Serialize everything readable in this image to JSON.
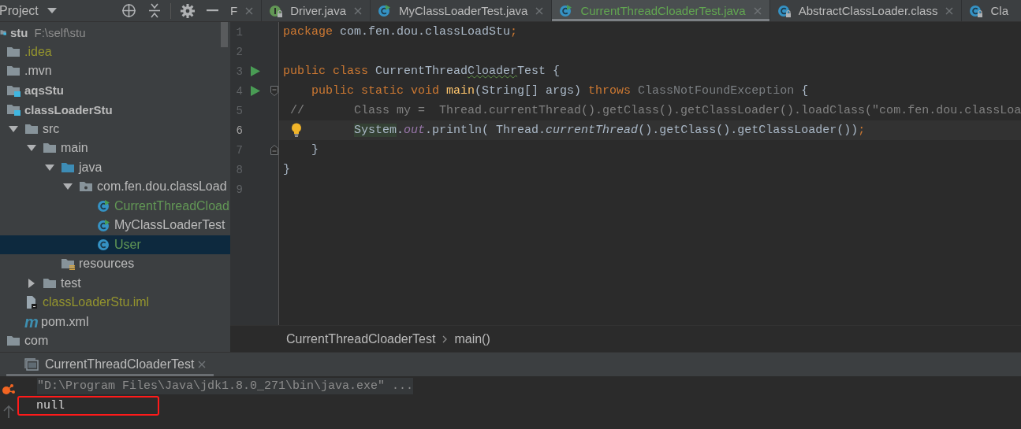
{
  "project_panel": {
    "title": "Project",
    "tree": [
      {
        "label": "stu",
        "kind": "module",
        "path": "F:\\self\\stu",
        "color": "#bbbbbb",
        "selected": false,
        "children": [
          {
            "label": ".idea",
            "kind": "folder",
            "color": "#94942e",
            "selected": false
          },
          {
            "label": ".mvn",
            "kind": "folder",
            "color": "#bbbbbb",
            "selected": false
          },
          {
            "label": "aqsStu",
            "kind": "module",
            "color": "#bbbbbb",
            "selected": false
          },
          {
            "label": "classLoaderStu",
            "kind": "module",
            "color": "#bbbbbb",
            "selected": false,
            "children": [
              {
                "label": "src",
                "kind": "folder",
                "color": "#bbbbbb",
                "expanded": true,
                "selected": false,
                "children": [
                  {
                    "label": "main",
                    "kind": "folder",
                    "color": "#bbbbbb",
                    "expanded": true,
                    "selected": false,
                    "children": [
                      {
                        "label": "java",
                        "kind": "source-folder",
                        "color": "#bbbbbb",
                        "expanded": true,
                        "selected": false,
                        "children": [
                          {
                            "label": "com.fen.dou.classLoad",
                            "kind": "package",
                            "color": "#bbbbbb",
                            "expanded": true,
                            "selected": false,
                            "children": [
                              {
                                "label": "CurrentThreadCload",
                                "kind": "runnable-class",
                                "color": "#629755",
                                "selected": false
                              },
                              {
                                "label": "MyClassLoaderTest",
                                "kind": "runnable-class",
                                "color": "#bbbbbb",
                                "selected": false
                              },
                              {
                                "label": "User",
                                "kind": "class",
                                "color": "#629755",
                                "selected": true
                              }
                            ]
                          }
                        ]
                      },
                      {
                        "label": "resources",
                        "kind": "resources-folder",
                        "color": "#bbbbbb",
                        "selected": false
                      }
                    ]
                  },
                  {
                    "label": "test",
                    "kind": "folder",
                    "color": "#bbbbbb",
                    "expanded": false,
                    "selected": false
                  }
                ]
              },
              {
                "label": "classLoaderStu.iml",
                "kind": "iml-file",
                "color": "#94942e",
                "selected": false
              },
              {
                "label": "pom.xml",
                "kind": "maven-file",
                "icon_text": "m",
                "color": "#bbbbbb",
                "selected": false
              }
            ]
          },
          {
            "label": "com",
            "kind": "folder",
            "color": "#bbbbbb",
            "selected": false
          }
        ]
      }
    ]
  },
  "editor_tabs": [
    {
      "label": "F",
      "kind": "none",
      "locked": false,
      "selected": false,
      "cut_start": true,
      "cut_end": false
    },
    {
      "label": "Driver.java",
      "kind": "interface",
      "locked": true,
      "selected": false,
      "cut_start": false,
      "cut_end": false
    },
    {
      "label": "MyClassLoaderTest.java",
      "kind": "runnable-class",
      "locked": false,
      "selected": false,
      "cut_start": false,
      "cut_end": false
    },
    {
      "label": "CurrentThreadCloaderTest.java",
      "kind": "runnable-class",
      "locked": false,
      "selected": true,
      "cut_start": false,
      "cut_end": false
    },
    {
      "label": "AbstractClassLoader.class",
      "kind": "compiled-class",
      "locked": true,
      "selected": false,
      "cut_start": false,
      "cut_end": false
    },
    {
      "label": "Cla",
      "kind": "compiled-class",
      "locked": true,
      "selected": false,
      "cut_start": false,
      "cut_end": true
    }
  ],
  "editor": {
    "lines": [
      {
        "number": "1",
        "run": false,
        "fold_start": false,
        "fold_end": false,
        "bulb": false,
        "current": false,
        "tokens": [
          {
            "text": "package",
            "kind": "keyword"
          },
          {
            "text": " com.fen.dou.classLoadStu",
            "kind": "plain"
          },
          {
            "text": ";",
            "kind": "keyword"
          }
        ]
      },
      {
        "number": "2",
        "run": false,
        "fold_start": false,
        "fold_end": false,
        "bulb": false,
        "current": false
      },
      {
        "number": "3",
        "run": true,
        "fold_start": false,
        "fold_end": false,
        "bulb": false,
        "current": false,
        "tokens": [
          {
            "text": "public class ",
            "kind": "keyword"
          },
          {
            "text": "CurrentThread",
            "kind": "plain"
          },
          {
            "text": "Cloader",
            "kind": "typo"
          },
          {
            "text": "Test {",
            "kind": "plain"
          }
        ]
      },
      {
        "number": "4",
        "run": true,
        "fold_start": true,
        "fold_end": false,
        "bulb": false,
        "current": false,
        "tokens": [
          {
            "text": "    public static void ",
            "kind": "keyword"
          },
          {
            "text": "main",
            "kind": "declaration"
          },
          {
            "text": "(String[] args) ",
            "kind": "plain"
          },
          {
            "text": "throws",
            "kind": "keyword"
          },
          {
            "text": " ClassNotFoundException",
            "kind": "unused"
          },
          {
            "text": " {",
            "kind": "plain"
          }
        ]
      },
      {
        "number": "5",
        "run": false,
        "fold_start": false,
        "fold_end": false,
        "bulb": false,
        "current": false,
        "tokens": [
          {
            "text": " //       Class my =  Thread.currentThread().getClass().getClassLoader().loadClass(\"com.fen.dou.classLoa",
            "kind": "comment"
          }
        ]
      },
      {
        "number": "6",
        "run": false,
        "fold_start": false,
        "fold_end": false,
        "bulb": true,
        "current": true,
        "tokens": [
          {
            "text": "          System",
            "kind": "highlight"
          },
          {
            "text": ".",
            "kind": "plain"
          },
          {
            "text": "out",
            "kind": "field"
          },
          {
            "text": ".println( Thread.",
            "kind": "plain"
          },
          {
            "text": "currentThread",
            "kind": "static-call"
          },
          {
            "text": "().getClass().getClassLoader())",
            "kind": "plain"
          },
          {
            "text": ";",
            "kind": "keyword"
          }
        ]
      },
      {
        "number": "7",
        "run": false,
        "fold_start": false,
        "fold_end": true,
        "bulb": false,
        "current": false,
        "tokens": [
          {
            "text": "    }",
            "kind": "plain"
          }
        ]
      },
      {
        "number": "8",
        "run": false,
        "fold_start": false,
        "fold_end": false,
        "bulb": false,
        "current": false,
        "tokens": [
          {
            "text": "}",
            "kind": "plain"
          }
        ]
      },
      {
        "number": "9",
        "run": false,
        "fold_start": false,
        "fold_end": false,
        "bulb": false,
        "current": false
      }
    ],
    "breadcrumb": [
      "CurrentThreadCloaderTest",
      "main()"
    ]
  },
  "run_panel": {
    "tab": {
      "label": "CurrentThreadCloaderTest",
      "selected": true
    },
    "lines": [
      {
        "text": "\"D:\\Program Files\\Java\\jdk1.8.0_271\\bin\\java.exe\" ...",
        "kind": "command",
        "marked": false
      },
      {
        "text": "null",
        "kind": "output",
        "marked": true
      }
    ]
  }
}
